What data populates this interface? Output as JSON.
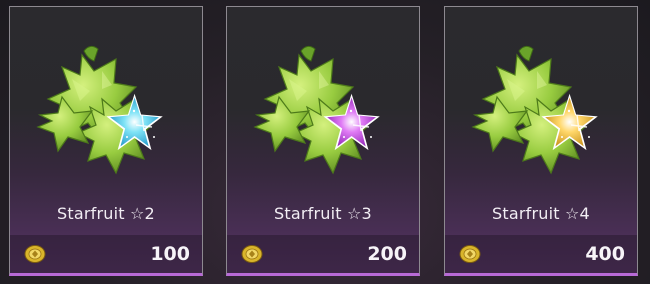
{
  "shop": {
    "items": [
      {
        "name": "Starfruit ☆2",
        "price": "100",
        "currency_icon": "coin-icon",
        "star_color": "#27b6e6",
        "star_inner": "#7fe3f6"
      },
      {
        "name": "Starfruit ☆3",
        "price": "200",
        "currency_icon": "coin-icon",
        "star_color": "#a62ad0",
        "star_inner": "#e07cf5"
      },
      {
        "name": "Starfruit ☆4",
        "price": "400",
        "currency_icon": "coin-icon",
        "star_color": "#e0a820",
        "star_inner": "#ffd76a"
      }
    ]
  },
  "colors": {
    "fruit_green": "#8ec83a",
    "fruit_light": "#c3e86e",
    "card_accent": "#b86ad6"
  }
}
